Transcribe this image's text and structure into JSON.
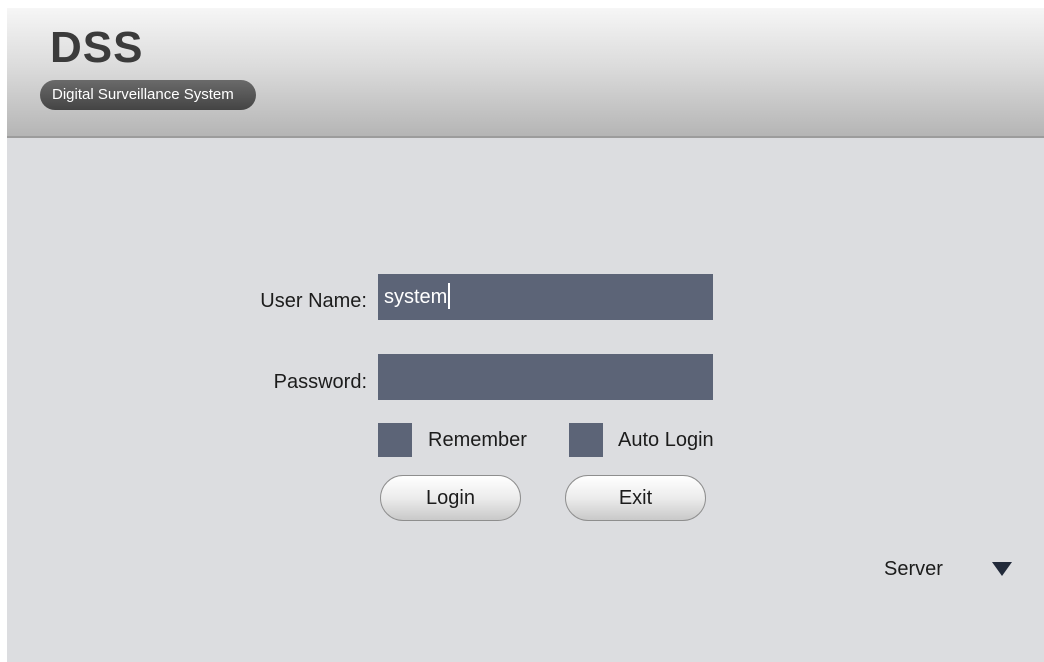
{
  "header": {
    "logo": "DSS",
    "subtitle": "Digital Surveillance System"
  },
  "login_form": {
    "username_label": "User Name:",
    "username_value": "system",
    "password_label": "Password:",
    "password_value": "",
    "remember_label": "Remember",
    "remember_checked": false,
    "auto_login_label": "Auto Login",
    "auto_login_checked": false,
    "login_button": "Login",
    "exit_button": "Exit"
  },
  "server": {
    "label": "Server",
    "toggle_icon": "triangle-down-icon"
  },
  "colors": {
    "input_fill": "#5c6477",
    "background": "#dcdde0",
    "header_dark": "#3b3b3b"
  }
}
